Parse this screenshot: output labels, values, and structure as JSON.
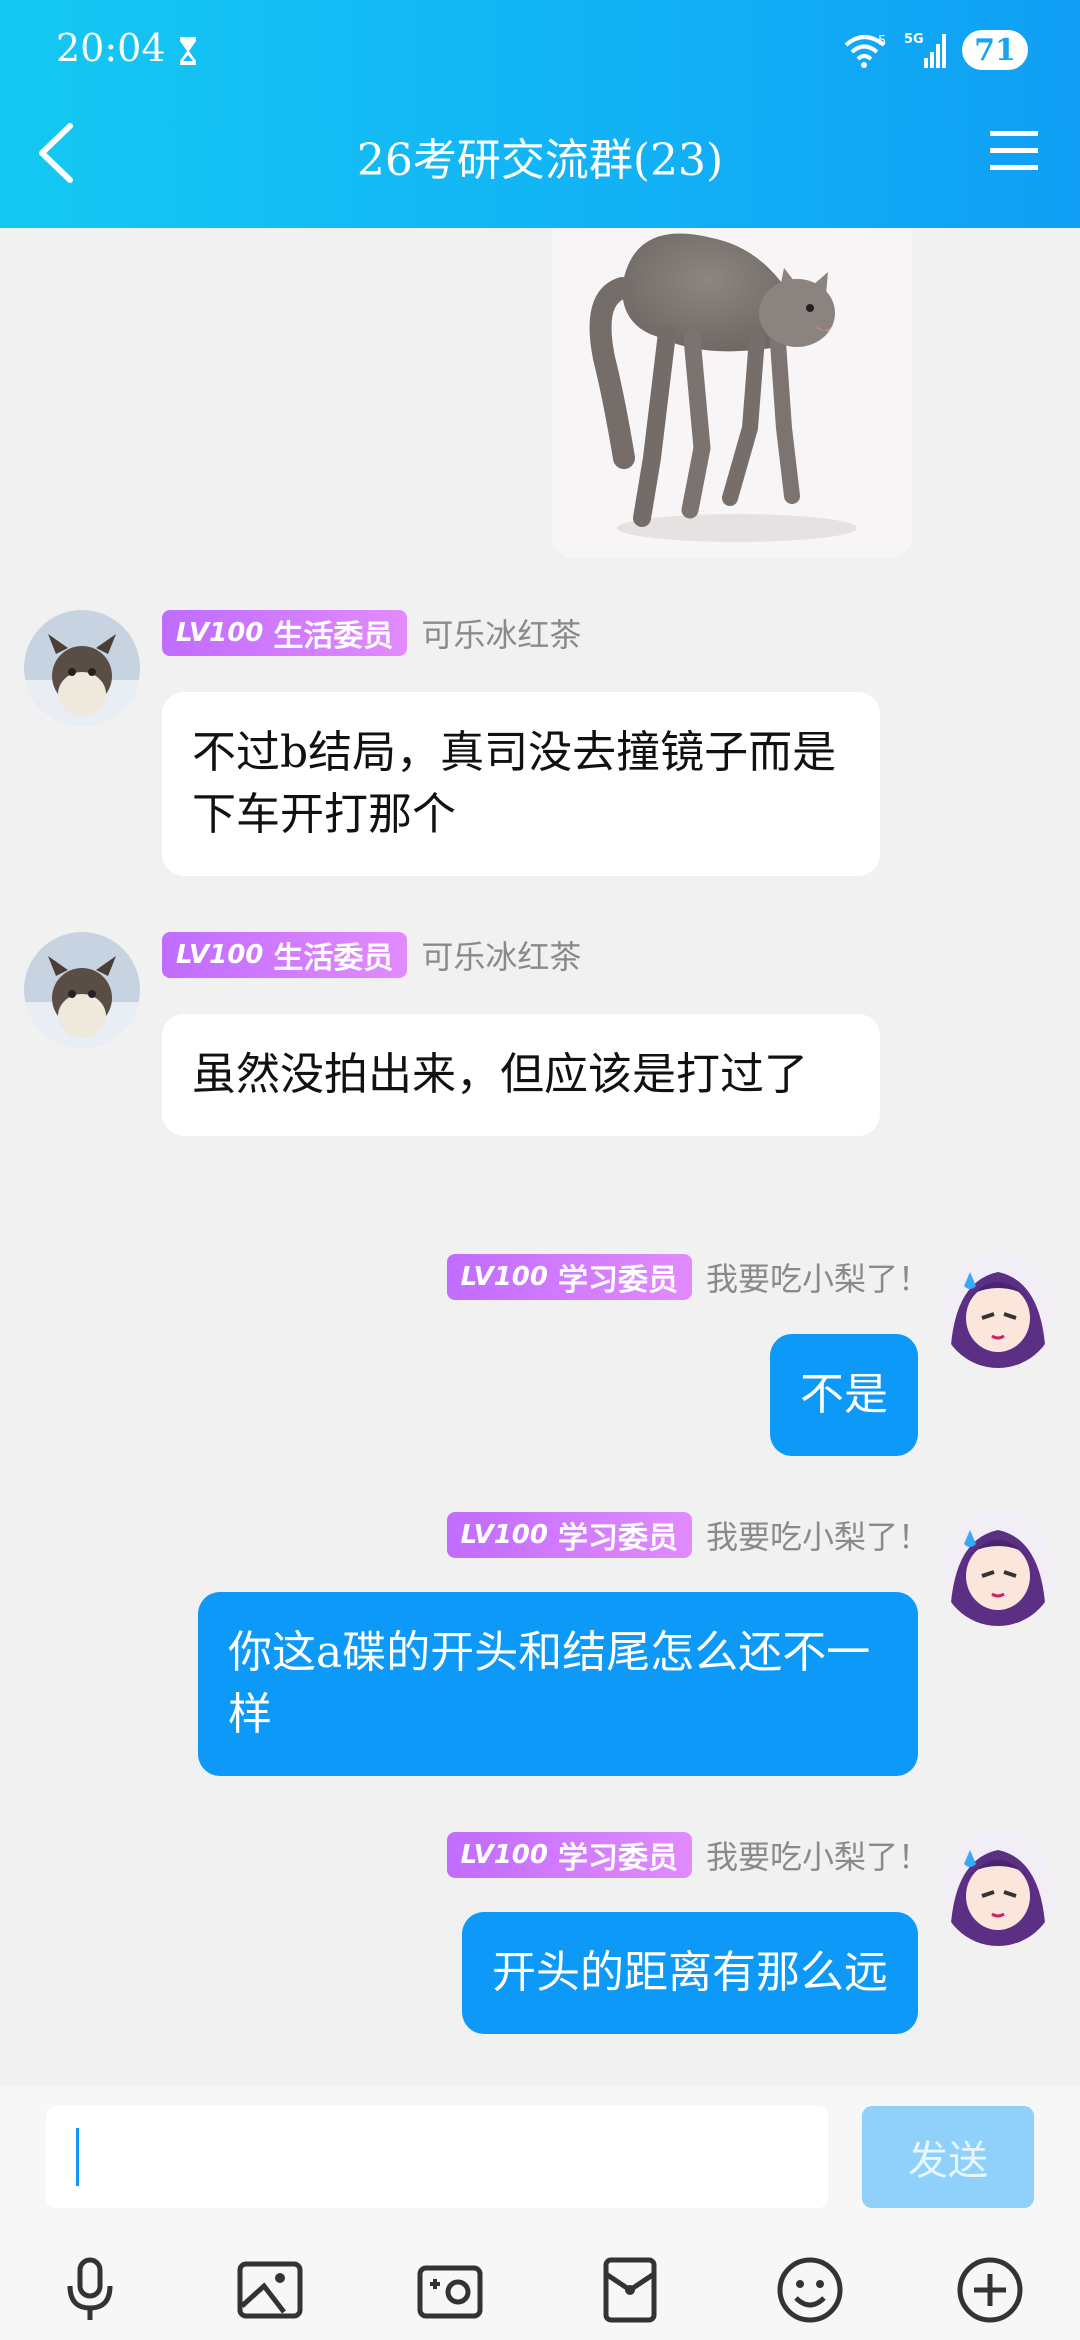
{
  "status_bar": {
    "time": "20:04",
    "wifi_label": "5",
    "network": "5G",
    "battery": "71"
  },
  "header": {
    "title": "26考研交流群(23)"
  },
  "messages": [
    {
      "type": "in",
      "badge_lv": "LV100",
      "badge_title": "生活委员",
      "sender": "可乐冰红茶",
      "text": "不过b结局，真司没去撞镜子而是下车开打那个"
    },
    {
      "type": "in",
      "badge_lv": "LV100",
      "badge_title": "生活委员",
      "sender": "可乐冰红茶",
      "text": "虽然没拍出来，但应该是打过了"
    },
    {
      "type": "out",
      "badge_lv": "LV100",
      "badge_title": "学习委员",
      "sender": "我要吃小梨了！",
      "text": "不是"
    },
    {
      "type": "out",
      "badge_lv": "LV100",
      "badge_title": "学习委员",
      "sender": "我要吃小梨了！",
      "text": "你这a碟的开头和结尾怎么还不一样"
    },
    {
      "type": "out",
      "badge_lv": "LV100",
      "badge_title": "学习委员",
      "sender": "我要吃小梨了！",
      "text": "开头的距离有那么远"
    }
  ],
  "input": {
    "value": "",
    "send_label": "发送"
  },
  "toolbar": {
    "icons": [
      "microphone-icon",
      "image-icon",
      "camera-icon",
      "red-packet-icon",
      "emoji-icon",
      "plus-icon"
    ]
  },
  "colors": {
    "header_start": "#14c8f2",
    "header_end": "#109ff5",
    "outgoing_bubble": "#0d99f7",
    "badge": "#c06cff",
    "send_button": "#8fd1fb"
  }
}
